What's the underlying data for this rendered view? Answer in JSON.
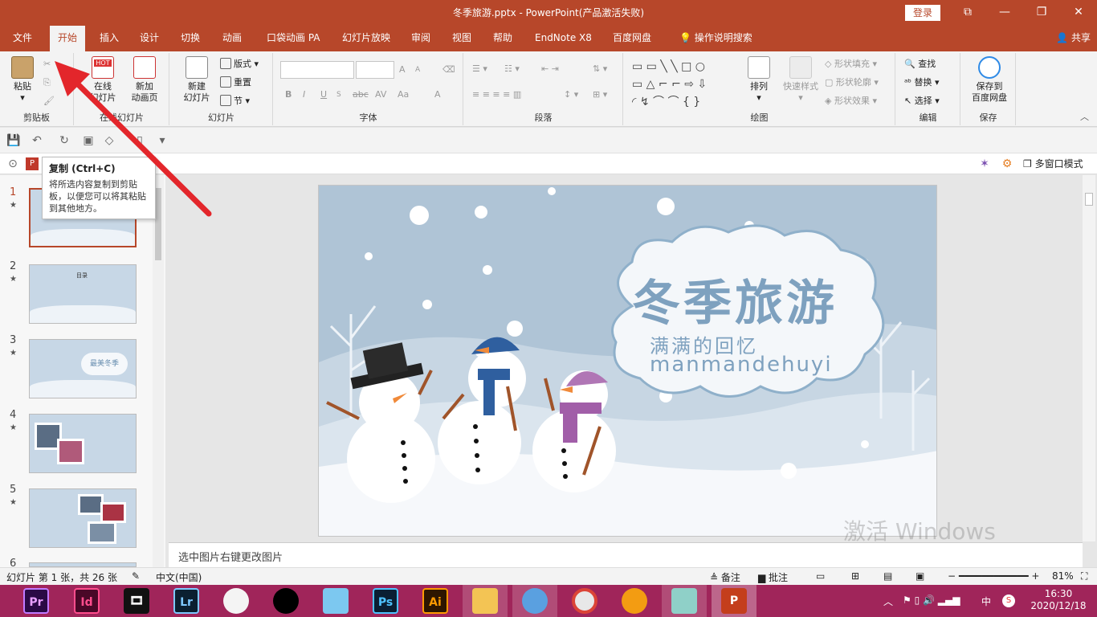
{
  "window": {
    "title": "冬季旅游.pptx  -  PowerPoint(产品激活失败)",
    "login_label": "登录",
    "controls": [
      "⧉",
      "—",
      "❐",
      "✕"
    ]
  },
  "tabs": [
    "文件",
    "开始",
    "插入",
    "设计",
    "切换",
    "动画",
    "口袋动画 PA",
    "幻灯片放映",
    "审阅",
    "视图",
    "帮助",
    "EndNote X8",
    "百度网盘",
    "操作说明搜索"
  ],
  "active_tab": "开始",
  "share_label": "共享",
  "ribbon": {
    "clipboard": {
      "paste": "粘贴",
      "label": "剪贴板"
    },
    "online": {
      "online_slide": "在线\n幻灯片",
      "add_anim": "新加\n动画页",
      "label": "在线幻灯片",
      "hot": "HOT"
    },
    "slides": {
      "new_slide": "新建\n幻灯片",
      "layout": "版式",
      "reset": "重置",
      "section": "节",
      "label": "幻灯片"
    },
    "font": {
      "label": "字体",
      "bold": "B",
      "italic": "I",
      "underline": "U",
      "strike": "abc",
      "spacing": "AV",
      "case": "Aa",
      "color": "A",
      "grow": "A",
      "shrink": "A"
    },
    "paragraph": {
      "label": "段落"
    },
    "drawing": {
      "arrange": "排列",
      "quick_style": "快速样式",
      "fill": "形状填充",
      "outline": "形状轮廓",
      "effect": "形状效果",
      "label": "绘图"
    },
    "editing": {
      "find": "查找",
      "replace": "替换",
      "select": "选择",
      "label": "编辑"
    },
    "save": {
      "save_baidu": "保存到\n百度网盘",
      "label": "保存"
    }
  },
  "view_bar": {
    "multi_window": "多窗口模式"
  },
  "tooltip": {
    "title": "复制 (Ctrl+C)",
    "body": "将所选内容复制到剪贴板，以便您可以将其粘贴到其他地方。"
  },
  "thumbnails": [
    {
      "num": "1",
      "star": "★"
    },
    {
      "num": "2",
      "star": "★"
    },
    {
      "num": "3",
      "star": "★"
    },
    {
      "num": "4",
      "star": "★"
    },
    {
      "num": "5",
      "star": "★"
    },
    {
      "num": "6",
      "star": ""
    }
  ],
  "slide": {
    "title": "冬季旅游",
    "subtitle": "满满的回忆",
    "pinyin": "manmandehuyi",
    "thumb2_label": "目录",
    "thumb3_label": "最美冬季"
  },
  "notes_placeholder": "选中图片右键更改图片",
  "status": {
    "slide_info": "幻灯片 第 1 张，共 26 张",
    "language": "中文(中国)",
    "notes": "备注",
    "comments": "批注",
    "zoom": "81%"
  },
  "activate_watermark": "激活 Windows",
  "taskbar": {
    "apps": [
      "Pr",
      "Id",
      "🎞",
      "Lr",
      "",
      "",
      "",
      "Ps",
      "Ai",
      "",
      "",
      "",
      "",
      "",
      "P"
    ],
    "ime": "中",
    "time": "16:30",
    "date": "2020/12/18"
  },
  "colors": {
    "accent": "#b7472a",
    "taskbar": "#a0255a",
    "slide_bg": "#afc4d6"
  }
}
